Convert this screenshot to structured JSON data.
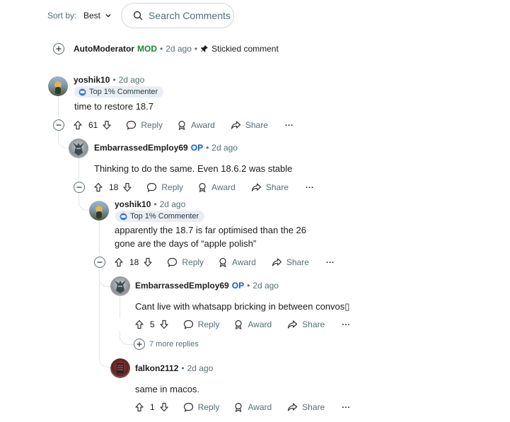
{
  "sort": {
    "label": "Sort by:",
    "value": "Best"
  },
  "search": {
    "placeholder": "Search Comments"
  },
  "automod": {
    "username": "AutoModerator",
    "mod_badge": "MOD",
    "sep1": "•",
    "time": "2d ago",
    "sep2": "•",
    "stickied_label": "Stickied comment"
  },
  "comments": [
    {
      "username": "yoshik10",
      "sep": "•",
      "time": "2d ago",
      "flair": "Top 1% Commenter",
      "text": "time to restore 18.7",
      "votes": "61",
      "reply": "Reply",
      "award": "Award",
      "share": "Share",
      "more": "···"
    },
    {
      "username": "EmbarrassedEmploy69",
      "op": "OP",
      "sep": "•",
      "time": "2d ago",
      "text": "Thinking to do the same. Even 18.6.2 was stable",
      "votes": "18",
      "reply": "Reply",
      "award": "Award",
      "share": "Share",
      "more": "···"
    },
    {
      "username": "yoshik10",
      "sep": "•",
      "time": "2d ago",
      "flair": "Top 1% Commenter",
      "text_lines": [
        "apparently the 18.7 is far optimised than the 26",
        "gone are the days of “apple polish”"
      ],
      "votes": "18",
      "reply": "Reply",
      "award": "Award",
      "share": "Share",
      "more": "···"
    },
    {
      "username": "EmbarrassedEmploy69",
      "op": "OP",
      "sep": "•",
      "time": "2d ago",
      "text": "Cant live with whatsapp bricking in between convos▯",
      "votes": "5",
      "reply": "Reply",
      "award": "Award",
      "share": "Share",
      "more": "···"
    },
    {
      "username": "falkon2112",
      "sep": "•",
      "time": "2d ago",
      "text": "same in macos.",
      "votes": "1",
      "reply": "Reply",
      "award": "Award",
      "share": "Share",
      "more": "···"
    }
  ],
  "more_replies": "7 more replies",
  "colors": {
    "op": "#0a5cd6",
    "mod": "#1b8b37",
    "meta": "#576f76",
    "thread_line": "#e3e5e7"
  }
}
